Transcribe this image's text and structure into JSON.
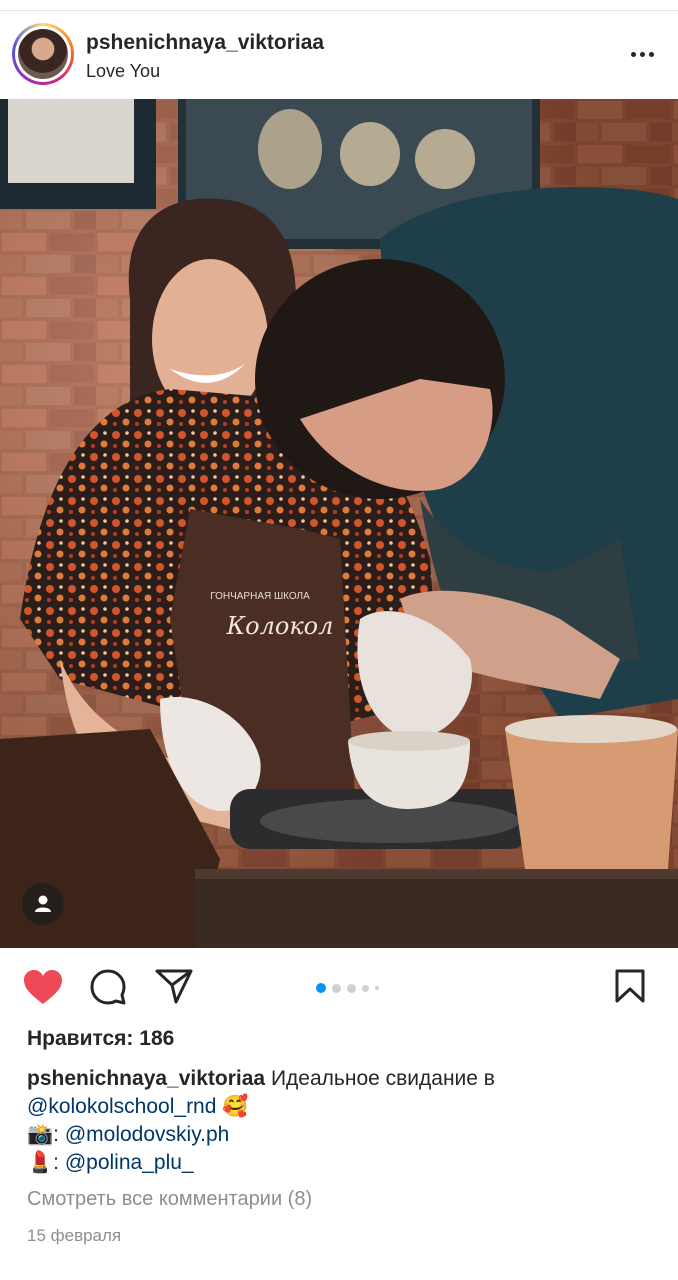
{
  "post": {
    "username": "pshenichnaya_viktoriaa",
    "location": "Love You",
    "likes_text": "Нравится: 186",
    "caption": {
      "username": "pshenichnaya_viktoriaa",
      "text": "Идеальное свидание в",
      "mention1": "@kolokolschool_rnd",
      "emoji1": "🥰",
      "line2_emoji": "📸",
      "line2_colon": ":",
      "mention2": "@molodovskiy.ph",
      "line3_emoji": "💄",
      "line3_colon": ":",
      "mention3": "@polina_plu_"
    },
    "view_comments": "Смотреть все комментарии (8)",
    "date": "15 февраля",
    "apron_text_small": "ГОНЧАРНАЯ ШКОЛА",
    "apron_text_logo": "Колокол",
    "carousel": {
      "count": 5,
      "active_index": 0
    }
  },
  "icons": {
    "more": "more-options-icon",
    "tag": "user-tag-icon",
    "like": "heart-icon",
    "comment": "comment-icon",
    "share": "share-icon",
    "save": "bookmark-icon"
  },
  "colors": {
    "like_red": "#ed4956",
    "carousel_active": "#0095f6",
    "link": "#00376b",
    "muted": "#8e8e8e"
  }
}
